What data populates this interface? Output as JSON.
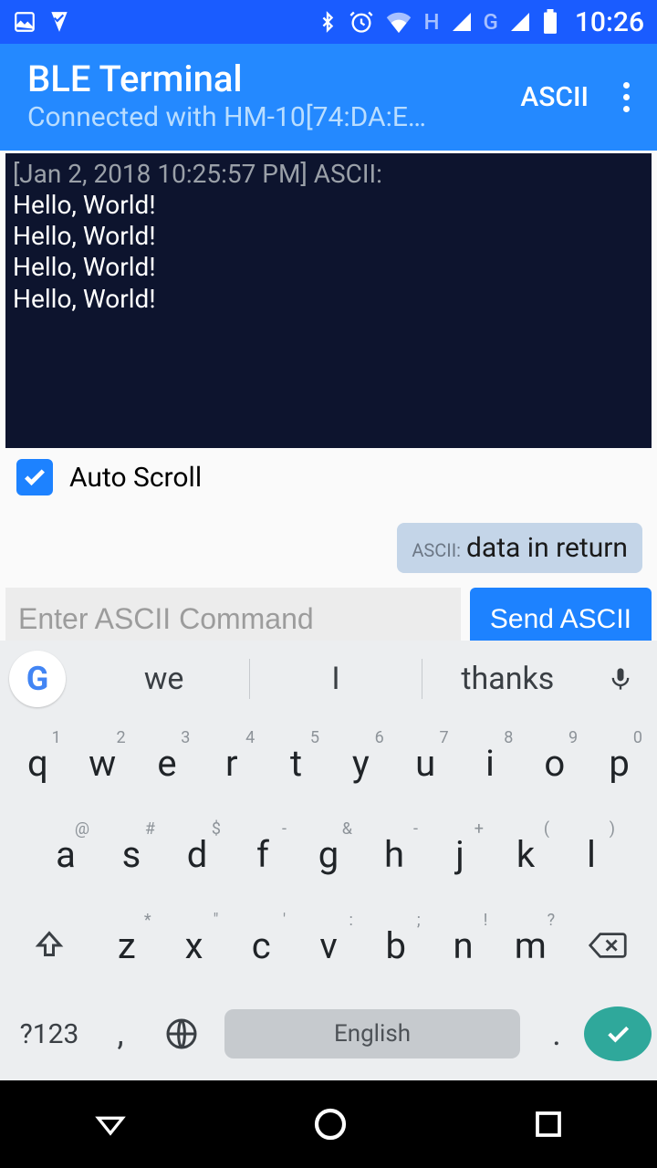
{
  "status": {
    "time": "10:26",
    "h_label": "H",
    "g_label": "G"
  },
  "app_bar": {
    "title": "BLE Terminal",
    "subtitle": "Connected with HM-10[74:DA:E…",
    "mode_label": "ASCII"
  },
  "terminal": {
    "timestamp": "[Jan 2, 2018 10:25:57 PM] ASCII:",
    "lines": [
      "Hello, World!",
      "Hello, World!",
      "Hello, World!",
      "Hello, World!"
    ]
  },
  "auto_scroll": {
    "label": "Auto Scroll",
    "checked": true
  },
  "bubble": {
    "prefix": "ASCII:",
    "text": "data in return"
  },
  "input": {
    "placeholder": "Enter ASCII Command",
    "send_label": "Send ASCII"
  },
  "keyboard": {
    "suggestions": [
      "we",
      "I",
      "thanks"
    ],
    "row1": [
      {
        "k": "q",
        "s": "1"
      },
      {
        "k": "w",
        "s": "2"
      },
      {
        "k": "e",
        "s": "3"
      },
      {
        "k": "r",
        "s": "4"
      },
      {
        "k": "t",
        "s": "5"
      },
      {
        "k": "y",
        "s": "6"
      },
      {
        "k": "u",
        "s": "7"
      },
      {
        "k": "i",
        "s": "8"
      },
      {
        "k": "o",
        "s": "9"
      },
      {
        "k": "p",
        "s": "0"
      }
    ],
    "row2": [
      {
        "k": "a",
        "s": "@"
      },
      {
        "k": "s",
        "s": "#"
      },
      {
        "k": "d",
        "s": "$"
      },
      {
        "k": "f",
        "s": "-"
      },
      {
        "k": "g",
        "s": "&"
      },
      {
        "k": "h",
        "s": "-"
      },
      {
        "k": "j",
        "s": "+"
      },
      {
        "k": "k",
        "s": "("
      },
      {
        "k": "l",
        "s": ")"
      }
    ],
    "row3": [
      {
        "k": "z",
        "s": "*"
      },
      {
        "k": "x",
        "s": "\""
      },
      {
        "k": "c",
        "s": "'"
      },
      {
        "k": "v",
        "s": ":"
      },
      {
        "k": "b",
        "s": ";"
      },
      {
        "k": "n",
        "s": "!"
      },
      {
        "k": "m",
        "s": "?"
      }
    ],
    "sym_label": "?123",
    "space_label": "English",
    "comma": ",",
    "dot": "."
  }
}
